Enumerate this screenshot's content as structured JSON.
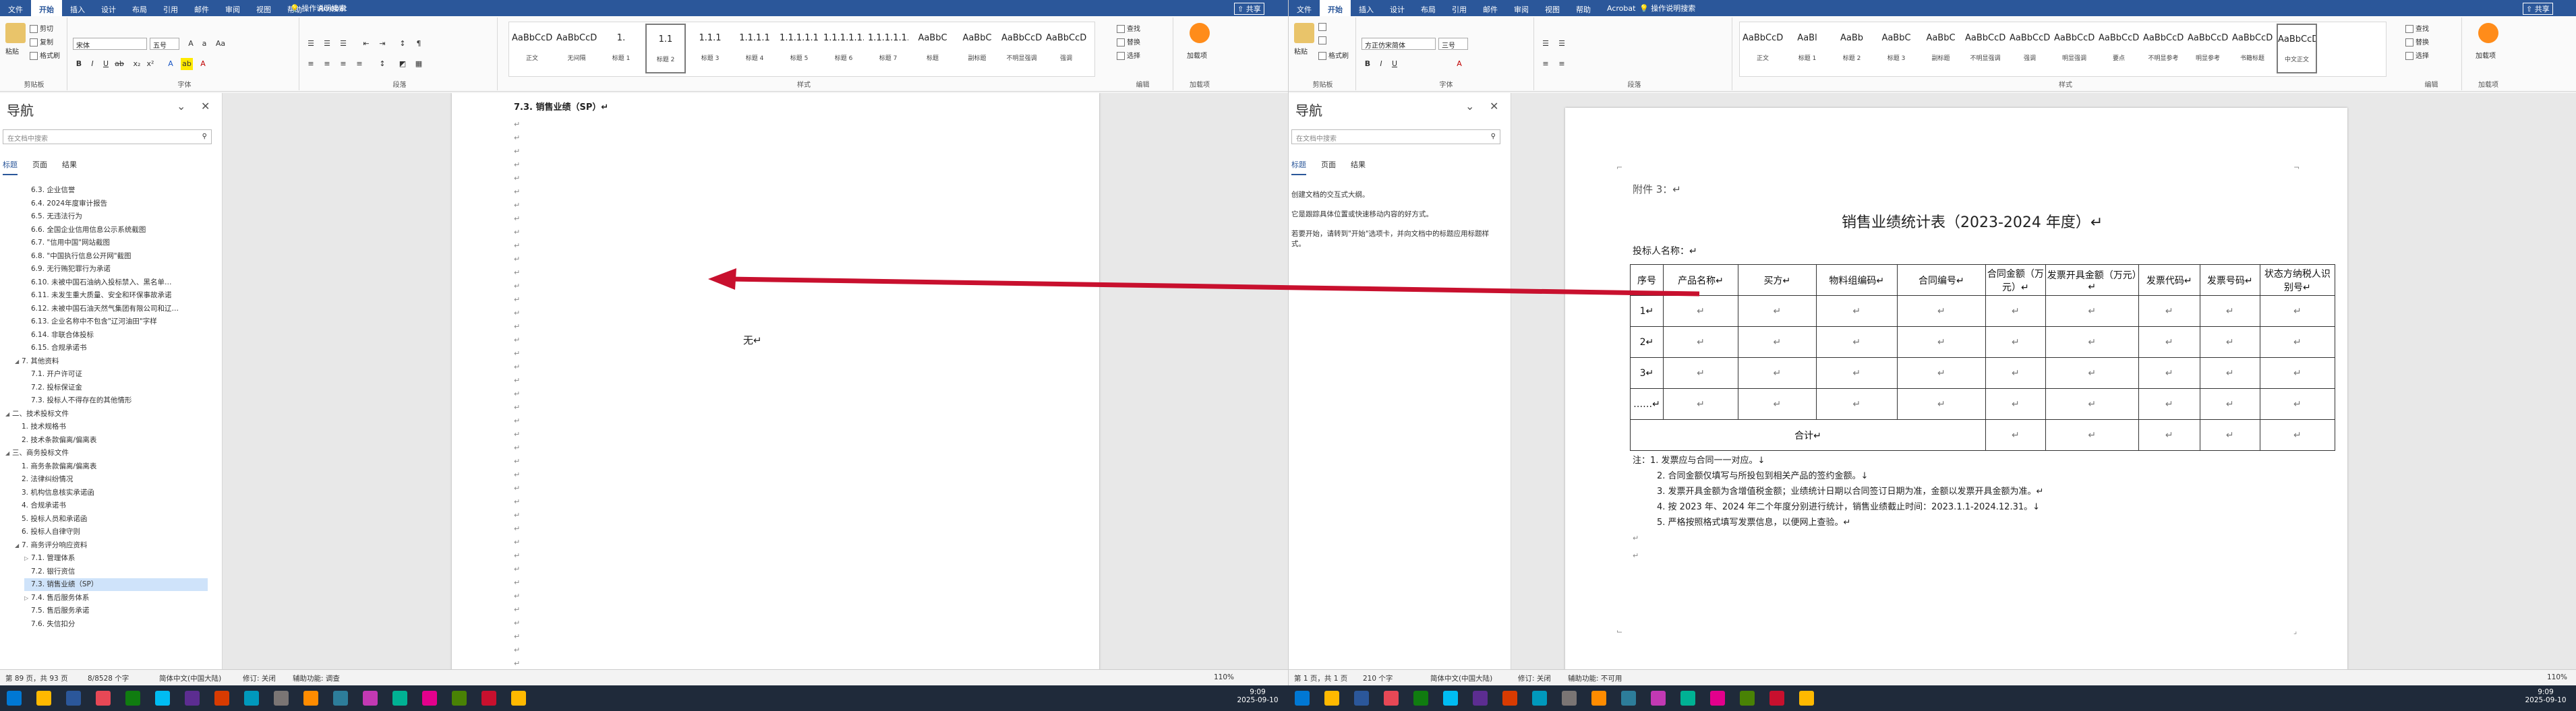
{
  "tabs": [
    "文件",
    "开始",
    "插入",
    "设计",
    "布局",
    "引用",
    "邮件",
    "审阅",
    "视图",
    "帮助",
    "Acrobat"
  ],
  "tell_me": "操作说明搜索",
  "share": "共享",
  "clipboard": {
    "paste": "粘贴",
    "cut": "剪切",
    "copy": "复制",
    "format_painter": "格式刷",
    "label": "剪贴板"
  },
  "font": {
    "name_left": "宋体",
    "name_right": "方正仿宋简体",
    "size_left": "五号",
    "size_right": "三号",
    "label": "字体"
  },
  "paragraph": {
    "label": "段落"
  },
  "styles_left": [
    {
      "preview": "AaBbCcDd",
      "name": "正文"
    },
    {
      "preview": "AaBbCcDd",
      "name": "无间隔"
    },
    {
      "preview": "1.",
      "name": "标题 1"
    },
    {
      "preview": "1.1",
      "name": "标题 2"
    },
    {
      "preview": "1.1.1",
      "name": "标题 3"
    },
    {
      "preview": "1.1.1.1",
      "name": "标题 4"
    },
    {
      "preview": "1.1.1.1.1",
      "name": "标题 5"
    },
    {
      "preview": "1.1.1.1.1.1",
      "name": "标题 6"
    },
    {
      "preview": "1.1.1.1.1.1.1",
      "name": "标题 7"
    },
    {
      "preview": "AaBbC",
      "name": "标题"
    },
    {
      "preview": "AaBbC",
      "name": "副标题"
    },
    {
      "preview": "AaBbCcD",
      "name": "不明显强调"
    },
    {
      "preview": "AaBbCcD",
      "name": "强调"
    }
  ],
  "styles_right": [
    {
      "preview": "AaBbCcDc",
      "name": "正文"
    },
    {
      "preview": "AaBl",
      "name": "标题 1"
    },
    {
      "preview": "AaBb",
      "name": "标题 2"
    },
    {
      "preview": "AaBbC",
      "name": "标题 3"
    },
    {
      "preview": "AaBbC",
      "name": "副标题"
    },
    {
      "preview": "AaBbCcDd",
      "name": "不明显强调"
    },
    {
      "preview": "AaBbCcDd",
      "name": "强调"
    },
    {
      "preview": "AaBbCcDd",
      "name": "明显强调"
    },
    {
      "preview": "AaBbCcDd",
      "name": "要点"
    },
    {
      "preview": "AaBbCcDd",
      "name": "不明显参考"
    },
    {
      "preview": "AaBbCcDd",
      "name": "明显参考"
    },
    {
      "preview": "AaBbCcDd",
      "name": "书籍标题"
    },
    {
      "preview": "AaBbCcDc",
      "name": "中文正文"
    }
  ],
  "styles_label": "样式",
  "editing": {
    "find": "查找",
    "replace": "替换",
    "select": "选择",
    "label": "编辑"
  },
  "addin": {
    "name": "加载项",
    "label": "加载项"
  },
  "nav": {
    "title": "导航",
    "search_placeholder": "在文档中搜索",
    "tabs": [
      "标题",
      "页面",
      "结果"
    ],
    "right_messages": [
      "创建文档的交互式大纲。",
      "它是跟踪具体位置或快速移动内容的好方式。",
      "若要开始，请转到\"开始\"选项卡，并向文档中的标题应用标题样式。"
    ]
  },
  "tree": [
    {
      "text": "6.3. 企业信誉",
      "lvl": 2,
      "tri": ""
    },
    {
      "text": "6.4. 2024年度审计报告",
      "lvl": 2,
      "tri": ""
    },
    {
      "text": "6.5. 无违法行为",
      "lvl": 2,
      "tri": ""
    },
    {
      "text": "6.6. 全国企业信用信息公示系统截图",
      "lvl": 2,
      "tri": ""
    },
    {
      "text": "6.7. \"信用中国\"网站截图",
      "lvl": 2,
      "tri": ""
    },
    {
      "text": "6.8. \"中国执行信息公开网\"截图",
      "lvl": 2,
      "tri": ""
    },
    {
      "text": "6.9. 无行贿犯罪行为承诺",
      "lvl": 2,
      "tri": ""
    },
    {
      "text": "6.10. 未被中国石油纳入投标禁入、黑名单…",
      "lvl": 2,
      "tri": ""
    },
    {
      "text": "6.11. 未发生重大质量、安全和环保事故承诺",
      "lvl": 2,
      "tri": ""
    },
    {
      "text": "6.12. 未被中国石油天然气集团有限公司和辽…",
      "lvl": 2,
      "tri": ""
    },
    {
      "text": "6.13. 企业名称中不包含\"辽河油田\"字样",
      "lvl": 2,
      "tri": ""
    },
    {
      "text": "6.14. 非联合体投标",
      "lvl": 2,
      "tri": ""
    },
    {
      "text": "6.15. 合规承诺书",
      "lvl": 2,
      "tri": ""
    },
    {
      "text": "7. 其他资料",
      "lvl": 1,
      "tri": "◢"
    },
    {
      "text": "7.1. 开户许可证",
      "lvl": 2,
      "tri": ""
    },
    {
      "text": "7.2. 投标保证金",
      "lvl": 2,
      "tri": ""
    },
    {
      "text": "7.3. 投标人不得存在的其他情形",
      "lvl": 2,
      "tri": ""
    },
    {
      "text": "二、技术投标文件",
      "lvl": 0,
      "tri": "◢"
    },
    {
      "text": "1. 技术规格书",
      "lvl": 1,
      "tri": ""
    },
    {
      "text": "2. 技术条款偏离/偏离表",
      "lvl": 1,
      "tri": ""
    },
    {
      "text": "三、商务投标文件",
      "lvl": 0,
      "tri": "◢"
    },
    {
      "text": "1. 商务条款偏离/偏离表",
      "lvl": 1,
      "tri": ""
    },
    {
      "text": "2. 法律纠纷情况",
      "lvl": 1,
      "tri": ""
    },
    {
      "text": "3. 机构信息核实承诺函",
      "lvl": 1,
      "tri": ""
    },
    {
      "text": "4. 合规承诺书",
      "lvl": 1,
      "tri": ""
    },
    {
      "text": "5. 投标人员和承诺函",
      "lvl": 1,
      "tri": ""
    },
    {
      "text": "6. 投标人自律守则",
      "lvl": 1,
      "tri": ""
    },
    {
      "text": "7. 商务评分响应资料",
      "lvl": 1,
      "tri": "◢"
    },
    {
      "text": "7.1. 管理体系",
      "lvl": 2,
      "tri": "▷"
    },
    {
      "text": "7.2. 银行资信",
      "lvl": 2,
      "tri": ""
    },
    {
      "text": "7.3. 销售业绩（SP）",
      "lvl": 2,
      "tri": "",
      "sel": true
    },
    {
      "text": "7.4. 售后服务体系",
      "lvl": 2,
      "tri": "▷"
    },
    {
      "text": "7.5. 售后服务承诺",
      "lvl": 2,
      "tri": ""
    },
    {
      "text": "7.6. 失信扣分",
      "lvl": 2,
      "tri": ""
    }
  ],
  "left_doc": {
    "heading": "7.3. 销售业绩（SP）↵",
    "center_text": "无↵",
    "para_mark": "↵"
  },
  "right_doc": {
    "attachment": "附件 3：↵",
    "title": "销售业绩统计表（2023-2024 年度）↵",
    "bidder": "投标人名称：↵",
    "headers": [
      "序号",
      "产品名称↵",
      "买方↵",
      "物料组编码↵",
      "合同编号↵",
      "合同金额（万元）↵",
      "发票开具金额（万元）↵",
      "发票代码↵",
      "发票号码↵",
      "状态方纳税人识别号↵"
    ],
    "rows": [
      [
        "1↵",
        "↵",
        "↵",
        "↵",
        "↵",
        "↵",
        "↵",
        "↵",
        "↵",
        "↵"
      ],
      [
        "2↵",
        "↵",
        "↵",
        "↵",
        "↵",
        "↵",
        "↵",
        "↵",
        "↵",
        "↵"
      ],
      [
        "3↵",
        "↵",
        "↵",
        "↵",
        "↵",
        "↵",
        "↵",
        "↵",
        "↵",
        "↵"
      ],
      [
        "……↵",
        "↵",
        "↵",
        "↵",
        "↵",
        "↵",
        "↵",
        "↵",
        "↵",
        "↵"
      ]
    ],
    "total_label": "合计↵",
    "notes": [
      "注：1. 发票应与合同一一对应。↓",
      "2. 合同金额仅填写与所投包到相关产品的签约金额。↓",
      "3. 发票开具金额为含增值税金额；业绩统计日期以合同签订日期为准，金额以发票开具金额为准。↵",
      "4. 按 2023 年、2024 年二个年度分别进行统计，销售业绩截止时间：2023.1.1-2024.12.31。↓",
      "5. 严格按照格式填写发票信息，以便网上查验。↵"
    ]
  },
  "status_left": {
    "page": "第 89 页，共 93 页",
    "words": "8/8528 个字",
    "lang": "简体中文(中国大陆)",
    "track": "修订: 关闭",
    "access": "辅助功能: 调查",
    "zoom": "110%"
  },
  "status_right": {
    "page": "第 1 页，共 1 页",
    "words": "210 个字",
    "lang": "简体中文(中国大陆)",
    "track": "修订: 关闭",
    "access": "辅助功能: 不可用",
    "zoom": "110%"
  },
  "clock": {
    "time": "9:09",
    "date": "2025-09-10"
  },
  "colors": {
    "word_blue": "#2b579a",
    "arrow_red": "#c8102e",
    "nav_sel": "#cfe3fa"
  }
}
